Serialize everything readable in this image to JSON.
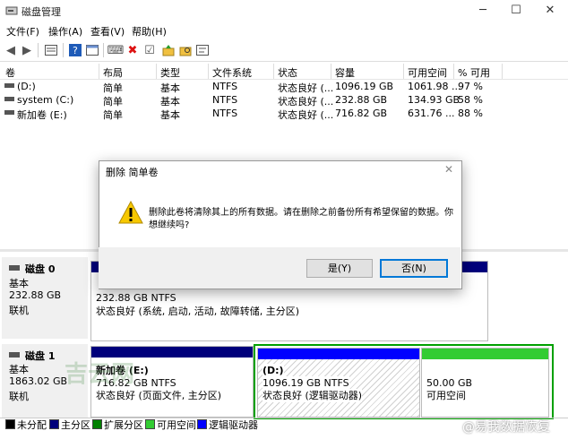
{
  "window": {
    "title": "磁盘管理",
    "minimize": "─",
    "maximize": "☐",
    "close": "✕"
  },
  "menu": [
    "文件(F)",
    "操作(A)",
    "查看(V)",
    "帮助(H)"
  ],
  "toolbar_icons": [
    "back-arrow-icon",
    "forward-arrow-icon",
    "list-view-icon",
    "help-icon",
    "properties-icon",
    "connect-icon",
    "delete-icon",
    "check-icon",
    "folder-up-icon",
    "folder-search-icon",
    "settings-icon"
  ],
  "volume_list": {
    "columns": [
      "卷",
      "布局",
      "类型",
      "文件系统",
      "状态",
      "容量",
      "可用空间",
      "% 可用"
    ],
    "rows": [
      [
        "(D:)",
        "简单",
        "基本",
        "NTFS",
        "状态良好 (...",
        "1096.19 GB",
        "1061.98 ...",
        "97 %"
      ],
      [
        "system (C:)",
        "简单",
        "基本",
        "NTFS",
        "状态良好 (...",
        "232.88 GB",
        "134.93 GB",
        "58 %"
      ],
      [
        "新加卷 (E:)",
        "简单",
        "基本",
        "NTFS",
        "状态良好 (...",
        "716.82 GB",
        "631.76 ...",
        "88 %"
      ]
    ]
  },
  "disks": {
    "disk0": {
      "name": "磁盘 0",
      "type": "基本",
      "size": "232.88 GB",
      "status": "联机",
      "partition_size": "232.88 GB NTFS",
      "partition_status": "状态良好 (系统, 启动, 活动, 故障转储, 主分区)"
    },
    "disk1": {
      "name": "磁盘 1",
      "type": "基本",
      "size": "1863.02 GB",
      "status": "联机",
      "p1_name": "新加卷 (E:)",
      "p1_size": "716.82 GB NTFS",
      "p1_status": "状态良好 (页面文件, 主分区)",
      "p2_name": "(D:)",
      "p2_size": "1096.19 GB NTFS",
      "p2_status": "状态良好 (逻辑驱动器)",
      "p3_size": "50.00 GB",
      "p3_status": "可用空间"
    }
  },
  "legend": [
    {
      "label": "未分配",
      "color": "#000000"
    },
    {
      "label": "主分区",
      "color": "#00007b"
    },
    {
      "label": "扩展分区",
      "color": "#008000"
    },
    {
      "label": "可用空间",
      "color": "#33cc33"
    },
    {
      "label": "逻辑驱动器",
      "color": "#0000ff"
    }
  ],
  "dialog": {
    "title": "删除 简单卷",
    "close": "✕",
    "message_line1": "删除此卷将清除其上的所有数据。请在删除之前备份所有希望保留的数据。你",
    "message_line2": "想继续吗?",
    "yes_label": "是(Y)",
    "no_label": "否(N)"
  },
  "watermarks": {
    "left": "吉云网",
    "right": "@易我数据恢复"
  }
}
